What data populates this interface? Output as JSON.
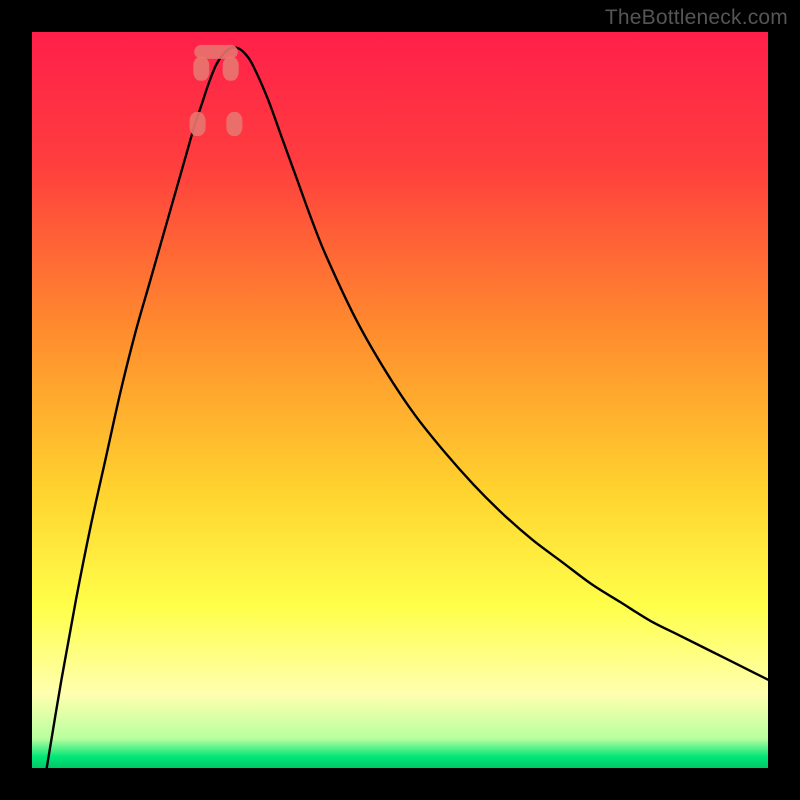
{
  "watermark": "TheBottleneck.com",
  "chart_data": {
    "type": "line",
    "title": "",
    "xlabel": "",
    "ylabel": "",
    "xlim": [
      0,
      100
    ],
    "ylim": [
      0,
      100
    ],
    "gradient_stops": [
      {
        "pos": 0.0,
        "color": "#ff1f4a"
      },
      {
        "pos": 0.18,
        "color": "#ff3e3e"
      },
      {
        "pos": 0.4,
        "color": "#ff8a2e"
      },
      {
        "pos": 0.62,
        "color": "#ffd22e"
      },
      {
        "pos": 0.78,
        "color": "#ffff4a"
      },
      {
        "pos": 0.9,
        "color": "#ffffb0"
      },
      {
        "pos": 0.96,
        "color": "#b8ff9e"
      },
      {
        "pos": 0.985,
        "color": "#00e676"
      },
      {
        "pos": 1.0,
        "color": "#00c868"
      }
    ],
    "series": [
      {
        "name": "bottleneck-curve",
        "stroke": "#000000",
        "stroke_width": 2.4,
        "x": [
          2,
          4,
          6,
          8,
          10,
          12,
          14,
          16,
          18,
          20,
          21,
          22,
          23,
          24,
          25,
          26,
          27,
          28,
          29,
          30,
          32,
          34,
          36,
          38,
          40,
          44,
          48,
          52,
          56,
          60,
          64,
          68,
          72,
          76,
          80,
          84,
          88,
          92,
          96,
          100
        ],
        "y": [
          0,
          12,
          23,
          33,
          42,
          51,
          59,
          66,
          73,
          80,
          83.5,
          87,
          90,
          93,
          95.5,
          97,
          97.8,
          97.8,
          97,
          95.5,
          91,
          85.5,
          80,
          74.5,
          69.5,
          61,
          54,
          48,
          43,
          38.5,
          34.5,
          31,
          28,
          25,
          22.5,
          20,
          18,
          16,
          14,
          12
        ]
      }
    ],
    "markers": [
      {
        "x": 22.5,
        "y": 87.5,
        "color": "#e8746e"
      },
      {
        "x": 27.5,
        "y": 87.5,
        "color": "#e8746e"
      },
      {
        "x": 23.0,
        "y": 95.0,
        "color": "#e8746e"
      },
      {
        "x": 27.0,
        "y": 95.0,
        "color": "#e8746e"
      }
    ],
    "trough_band": {
      "x0": 23,
      "x1": 27,
      "y": 97.3,
      "color": "#e8746e"
    }
  }
}
